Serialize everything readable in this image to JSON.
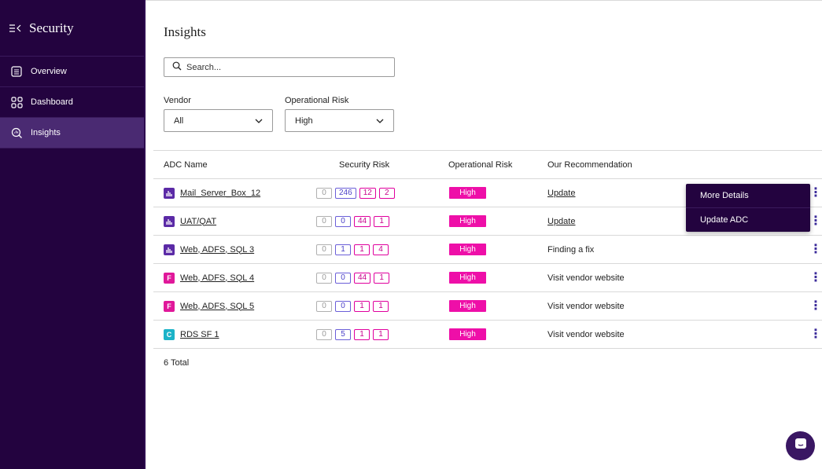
{
  "sidebar": {
    "title": "Security",
    "collapse_icon": "collapse-menu-icon",
    "items": [
      {
        "label": "Overview",
        "icon": "list-icon",
        "active": false
      },
      {
        "label": "Dashboard",
        "icon": "grid-icon",
        "active": false
      },
      {
        "label": "Insights",
        "icon": "insights-icon",
        "active": true
      }
    ]
  },
  "page": {
    "title": "Insights"
  },
  "search": {
    "placeholder": "Search..."
  },
  "filters": {
    "vendor": {
      "label": "Vendor",
      "value": "All"
    },
    "operational_risk": {
      "label": "Operational Risk",
      "value": "High"
    }
  },
  "table": {
    "headers": {
      "name": "ADC Name",
      "security": "Security Risk",
      "operational": "Operational Risk",
      "recommendation": "Our Recommendation"
    },
    "rows": [
      {
        "icon_letter": "",
        "icon_color": "#5b2aa6",
        "name": "Mail_Server_Box_12",
        "sec": [
          "0",
          "246",
          "12",
          "2"
        ],
        "risk": "High",
        "rec": "Update",
        "rec_link": true
      },
      {
        "icon_letter": "",
        "icon_color": "#5b2aa6",
        "name": "UAT/QAT",
        "sec": [
          "0",
          "0",
          "44",
          "1"
        ],
        "risk": "High",
        "rec": "Update",
        "rec_link": true
      },
      {
        "icon_letter": "",
        "icon_color": "#5b2aa6",
        "name": "Web, ADFS, SQL 3",
        "sec": [
          "0",
          "1",
          "1",
          "4"
        ],
        "risk": "High",
        "rec": "Finding a fix",
        "rec_link": false
      },
      {
        "icon_letter": "F",
        "icon_color": "#e0189a",
        "name": "Web, ADFS, SQL 4",
        "sec": [
          "0",
          "0",
          "44",
          "1"
        ],
        "risk": "High",
        "rec": "Visit vendor website",
        "rec_link": false
      },
      {
        "icon_letter": "F",
        "icon_color": "#e0189a",
        "name": "Web, ADFS, SQL 5",
        "sec": [
          "0",
          "0",
          "1",
          "1"
        ],
        "risk": "High",
        "rec": "Visit vendor website",
        "rec_link": false
      },
      {
        "icon_letter": "C",
        "icon_color": "#1bb3c8",
        "name": "RDS SF 1",
        "sec": [
          "0",
          "5",
          "1",
          "1"
        ],
        "risk": "High",
        "rec": "Visit vendor website",
        "rec_link": false
      }
    ],
    "total": "6 Total"
  },
  "context_menu": {
    "items": [
      "More Details",
      "Update ADC"
    ]
  },
  "colors": {
    "sidebar_bg": "#23033f",
    "risk_high": "#ee0fa8",
    "accent": "#3b2b9a"
  }
}
